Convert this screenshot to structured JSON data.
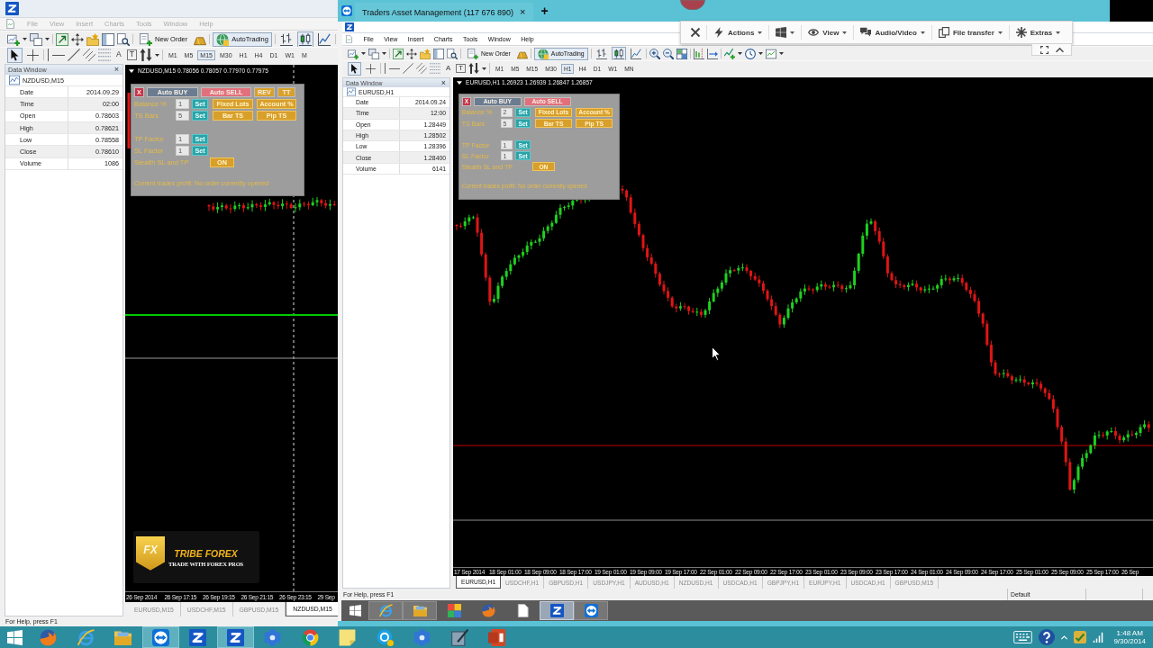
{
  "local_window": {
    "active": false,
    "menu": [
      "File",
      "View",
      "Insert",
      "Charts",
      "Tools",
      "Window",
      "Help"
    ],
    "toolbar": {
      "new_order": "New Order",
      "auto_trading": {
        "label": "AutoTrading",
        "on": true
      }
    },
    "chart_types": [
      {
        "selected": false
      },
      {
        "selected": true
      },
      {
        "selected": false
      }
    ],
    "cursor_tools": [
      {
        "selected": true
      },
      {
        "selected": false
      }
    ],
    "text_tools": [
      "A",
      "T"
    ],
    "periods": [
      {
        "label": "M1",
        "selected": false
      },
      {
        "label": "M5",
        "selected": false
      },
      {
        "label": "M15",
        "selected": true
      },
      {
        "label": "M30",
        "selected": false
      },
      {
        "label": "H1",
        "selected": false
      },
      {
        "label": "H4",
        "selected": false
      },
      {
        "label": "D1",
        "selected": false
      },
      {
        "label": "W1",
        "selected": false
      },
      {
        "label": "M",
        "selected": false
      }
    ],
    "data_window": {
      "title": "Data Window",
      "close": "×",
      "symbol": "NZDUSD,M15",
      "rows": [
        {
          "name": "Date",
          "value": "2014.09.29"
        },
        {
          "name": "Time",
          "value": "02:00"
        },
        {
          "name": "Open",
          "value": "0.78603"
        },
        {
          "name": "High",
          "value": "0.78621"
        },
        {
          "name": "Low",
          "value": "0.78558"
        },
        {
          "name": "Close",
          "value": "0.78610"
        },
        {
          "name": "Volume",
          "value": "1086"
        }
      ]
    },
    "chart": {
      "header": "NZDUSD,M15 0.78056 0.78057 0.77970 0.77975",
      "panel": {
        "top_buttons": [
          {
            "label": "X",
            "color": "#c8344c"
          },
          {
            "label": "Auto BUY",
            "color": "#6b7c90"
          },
          {
            "label": "Auto SELL",
            "color": "#e2707c"
          },
          {
            "label": "REV",
            "color": "#d9a12a"
          },
          {
            "label": "TT",
            "color": "#d9a12a"
          }
        ],
        "sizing_rows": [
          {
            "label": "Balance %",
            "value": "1",
            "action": "Set",
            "options": [
              "Fixed Lots",
              "Account %"
            ]
          },
          {
            "label": "TS Bars",
            "value": "5",
            "action": "Set",
            "options": [
              "Bar TS",
              "Pip TS"
            ]
          }
        ],
        "factor_rows": [
          {
            "label": "TP Factor",
            "value": "1",
            "action": "Set"
          },
          {
            "label": "SL Factor",
            "value": "1",
            "action": "Set"
          }
        ],
        "stealth": {
          "label": "Stealth SL and TP",
          "button": "ON"
        },
        "status": "Current trades profit: No order currently opened"
      },
      "logo": {
        "mark": "FX",
        "name": "TRIBE FOREX",
        "tagline": "TRADE WITH FOREX PROS"
      },
      "time_axis": [
        "26 Sep 2014",
        "26 Sep 17:15",
        "26 Sep 19:15",
        "26 Sep 21:15",
        "26 Sep 23:15",
        "29 Sep"
      ]
    },
    "chart_tabs": [
      {
        "label": "EURUSD,M15",
        "selected": false
      },
      {
        "label": "USDCHF,M15",
        "selected": false
      },
      {
        "label": "GBPUSD,M15",
        "selected": false
      },
      {
        "label": "NZDUSD,M15",
        "selected": true
      }
    ],
    "status": "For Help, press F1"
  },
  "remote_session": {
    "tab": {
      "title": "Traders Asset Management (117 676 890)",
      "close": "×"
    },
    "new_tab": "+",
    "toolbar": [
      {
        "kind": "menu",
        "label": "Actions"
      },
      {
        "kind": "icon_menu"
      },
      {
        "kind": "menu",
        "label": "View"
      },
      {
        "kind": "menu",
        "label": "Audio/Video"
      },
      {
        "kind": "menu",
        "label": "File transfer"
      },
      {
        "kind": "menu",
        "label": "Extras"
      }
    ],
    "window": {
      "active": true,
      "menu": [
        "File",
        "View",
        "Insert",
        "Charts",
        "Tools",
        "Window",
        "Help"
      ],
      "toolbar": {
        "new_order": "New Order",
        "auto_trading": {
          "label": "AutoTrading",
          "on": true
        }
      },
      "chart_types": [
        {
          "selected": false
        },
        {
          "selected": true
        },
        {
          "selected": false
        }
      ],
      "cursor_tools": [
        {
          "selected": true
        },
        {
          "selected": false
        }
      ],
      "text_tools": [
        "A",
        "T"
      ],
      "periods": [
        {
          "label": "M1",
          "selected": false
        },
        {
          "label": "M5",
          "selected": false
        },
        {
          "label": "M15",
          "selected": false
        },
        {
          "label": "M30",
          "selected": false
        },
        {
          "label": "H1",
          "selected": true
        },
        {
          "label": "H4",
          "selected": false
        },
        {
          "label": "D1",
          "selected": false
        },
        {
          "label": "W1",
          "selected": false
        },
        {
          "label": "MN",
          "selected": false
        }
      ],
      "data_window": {
        "title": "Data Window",
        "close": "×",
        "symbol": "EURUSD,H1",
        "rows": [
          {
            "name": "Date",
            "value": "2014.09.24"
          },
          {
            "name": "Time",
            "value": "12:00"
          },
          {
            "name": "Open",
            "value": "1.28449"
          },
          {
            "name": "High",
            "value": "1.28502"
          },
          {
            "name": "Low",
            "value": "1.28396"
          },
          {
            "name": "Close",
            "value": "1.28400"
          },
          {
            "name": "Volume",
            "value": "6141"
          }
        ]
      },
      "chart": {
        "header": "EURUSD,H1 1.26923 1.26939 1.26847 1.26857",
        "panel": {
          "top_buttons": [
            {
              "label": "X",
              "color": "#c8344c"
            },
            {
              "label": "Auto BUY",
              "color": "#6b7c90"
            },
            {
              "label": "Auto SELL",
              "color": "#e2707c"
            }
          ],
          "sizing_rows": [
            {
              "label": "Balance %",
              "value": "2",
              "action": "Set",
              "options": [
                "Fixed Lots",
                "Account %"
              ]
            },
            {
              "label": "TS Bars",
              "value": "5",
              "action": "Set",
              "options": [
                "Bar TS",
                "Pip TS"
              ]
            }
          ],
          "factor_rows": [
            {
              "label": "TP Factor",
              "value": "1",
              "action": "Set"
            },
            {
              "label": "SL Factor",
              "value": "1",
              "action": "Set"
            }
          ],
          "stealth": {
            "label": "Stealth SL and TP",
            "button": "ON"
          },
          "status": "Current trades profit: No order currently opened"
        },
        "time_axis": [
          "17 Sep 2014",
          "18 Sep 01:00",
          "18 Sep 09:00",
          "18 Sep 17:00",
          "19 Sep 01:00",
          "19 Sep 09:00",
          "19 Sep 17:00",
          "22 Sep 01:00",
          "22 Sep 09:00",
          "22 Sep 17:00",
          "23 Sep 01:00",
          "23 Sep 09:00",
          "23 Sep 17:00",
          "24 Sep 01:00",
          "24 Sep 09:00",
          "24 Sep 17:00",
          "25 Sep 01:00",
          "25 Sep 09:00",
          "25 Sep 17:00",
          "26 Sep"
        ]
      },
      "chart_tabs": [
        {
          "label": "EURUSD,H1",
          "selected": true
        },
        {
          "label": "USDCHF,H1",
          "selected": false
        },
        {
          "label": "GBPUSD,H1",
          "selected": false
        },
        {
          "label": "USDJPY,H1",
          "selected": false
        },
        {
          "label": "AUDUSD,H1",
          "selected": false
        },
        {
          "label": "NZDUSD,H1",
          "selected": false
        },
        {
          "label": "USDCAD,H1",
          "selected": false
        },
        {
          "label": "GBPJPY,H1",
          "selected": false
        },
        {
          "label": "EURJPY,H1",
          "selected": false
        },
        {
          "label": "USDCAD,H1",
          "selected": false
        },
        {
          "label": "GBPUSD,M15",
          "selected": false
        }
      ],
      "status": "For Help, press F1",
      "status_right": "Default"
    },
    "taskbar": {
      "apps": [
        {
          "open": true,
          "selected": false
        },
        {
          "open": true,
          "selected": false
        },
        {
          "open": false,
          "selected": false
        },
        {
          "open": false,
          "selected": false
        },
        {
          "open": false,
          "selected": false
        },
        {
          "open": true,
          "selected": true
        },
        {
          "open": true,
          "selected": false
        }
      ]
    }
  },
  "taskbar": {
    "apps": [
      {
        "open": false
      },
      {
        "open": false
      },
      {
        "open": false
      },
      {
        "open": true
      },
      {
        "open": false
      },
      {
        "open": true
      },
      {
        "open": false
      },
      {
        "open": false
      },
      {
        "open": false
      },
      {
        "open": false
      },
      {
        "open": false
      },
      {
        "open": false
      },
      {
        "open": false
      }
    ],
    "clock": {
      "time": "1:48 AM",
      "date": "9/30/2014"
    }
  }
}
